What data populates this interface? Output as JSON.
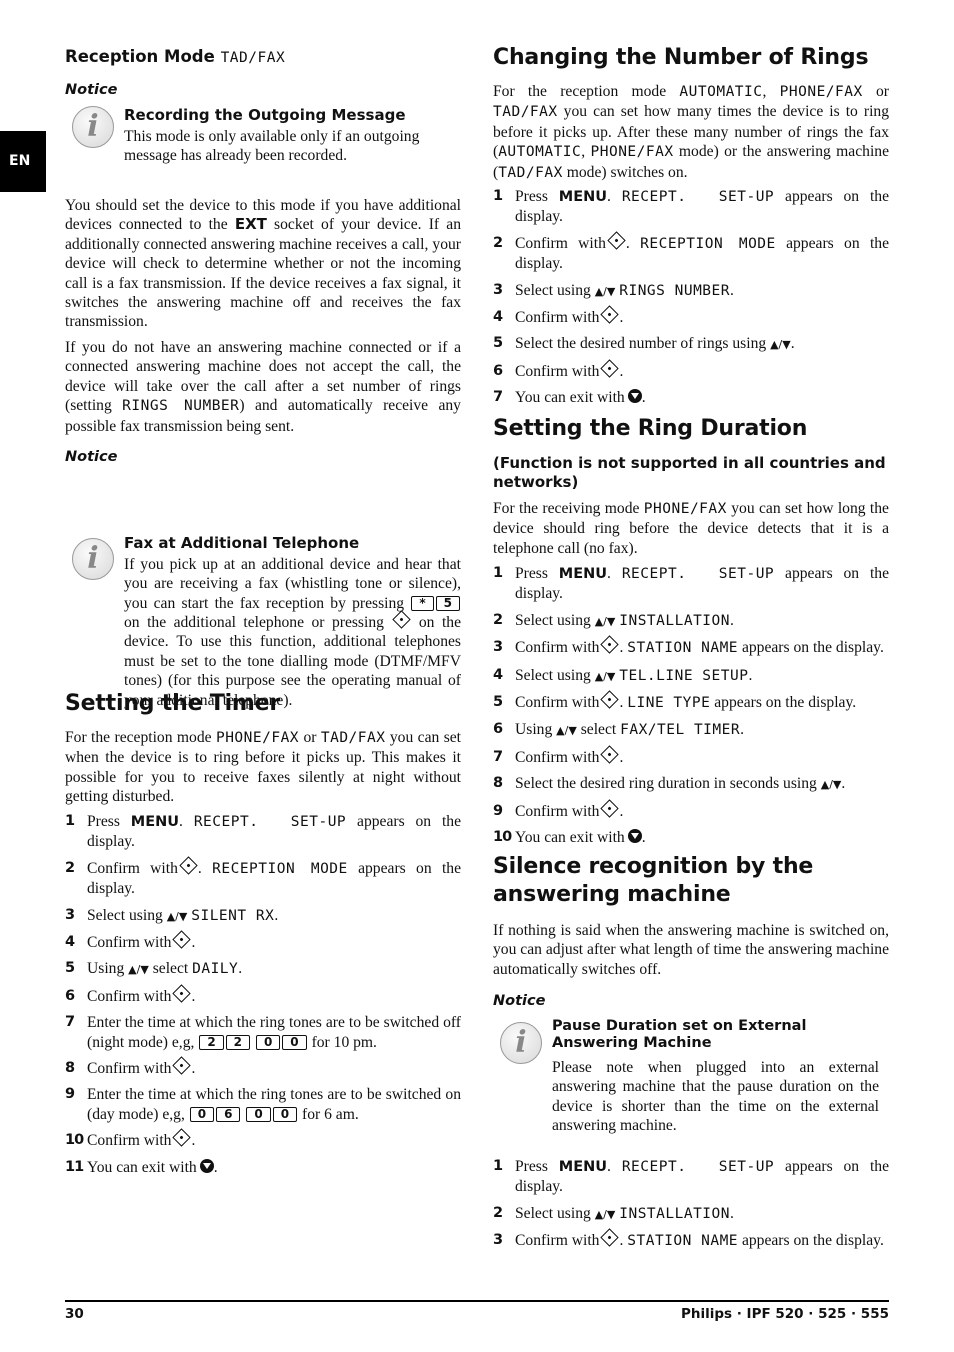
{
  "lang_tab": "EN",
  "left": {
    "reception_heading": "Reception Mode",
    "reception_heading_mode": "TAD/FAX",
    "notice1": {
      "label": "Notice",
      "title": "Recording the Outgoing Message",
      "text": "This mode is only available only if an outgoing message has already been recorded."
    },
    "para1_a": "You should set the device to this mode if you have additional devices connected to the",
    "para1_ext": "EXT",
    "para1_b": "socket of your device. If an additionally connected answering machine receives a call, your device will check to determine whether or not the incoming call is a fax transmission. If the device receives a fax signal, it switches the answering machine off and receives the fax transmission.",
    "para2_a": "If you do not have an answering machine connected or if a connected answering machine does not accept the call, the device will take over the call after a set number of rings (setting",
    "para2_lcd": "RINGS NUMBER",
    "para2_b": ") and automatically receive any possible fax transmission being sent.",
    "notice2": {
      "label": "Notice",
      "title": "Fax at Additional Telephone",
      "text_a": "If you pick up at an additional device and hear that you are receiving a fax (whistling tone or silence), you can start the fax reception by pressing",
      "keys": [
        "*",
        "5"
      ],
      "text_b": "on the additional telephone or pressing",
      "text_c": "on the device. To use this function, additional telephones must be set to the tone dialling mode (DTMF/MFV tones) (for this purpose see the operating manual of your additional telephone)."
    },
    "timer": {
      "heading": "Setting the Timer",
      "intro_a": "For the reception mode",
      "intro_lcd1": "PHONE/FAX",
      "intro_or": "or",
      "intro_lcd2": "TAD/FAX",
      "intro_b": "you can set when the device is to ring before it picks up. This makes it possible for you to receive faxes silently at night without getting disturbed.",
      "steps": [
        {
          "num": "1",
          "a": "Press",
          "bold": "MENU",
          "b": ".",
          "lcd": "RECEPT.  SET-UP",
          "c": "appears on the display."
        },
        {
          "num": "2",
          "a": "Confirm with",
          "b": ".",
          "lcd": "RECEPTION MODE",
          "c": "appears on the display."
        },
        {
          "num": "3",
          "a": "Select using",
          "lcd": "SILENT RX",
          "c": "."
        },
        {
          "num": "4",
          "a": "Confirm with",
          "c": "."
        },
        {
          "num": "5",
          "a": "Using",
          "b": "select",
          "lcd": "DAILY",
          "c": "."
        },
        {
          "num": "6",
          "a": "Confirm with",
          "c": "."
        },
        {
          "num": "7",
          "a": "Enter the time at which the ring tones are to be switched off (night mode) e,g,",
          "keys1": [
            "2",
            "2"
          ],
          "keys2": [
            "0",
            "0"
          ],
          "c": "for 10 pm."
        },
        {
          "num": "8",
          "a": "Confirm with",
          "c": "."
        },
        {
          "num": "9",
          "a": "Enter the time at which the ring tones are to be switched on (day mode) e,g,",
          "keys1": [
            "0",
            "6"
          ],
          "keys2": [
            "0",
            "0"
          ],
          "c": "for 6 am."
        },
        {
          "num": "10",
          "a": "Confirm with",
          "c": "."
        },
        {
          "num": "11",
          "a": "You can exit with",
          "c": "."
        }
      ]
    }
  },
  "right": {
    "rings": {
      "heading": "Changing the Number of Rings",
      "intro_a": "For the reception mode",
      "lcd_auto": "AUTOMATIC",
      "lcd_phonefax": "PHONE/FAX",
      "lcd_tadfax": "TAD/FAX",
      "intro_or": "or",
      "intro_b": "you can set how many times the device is to ring before it picks up. After these many number of rings the fax",
      "intro_c": "mode) or the answering machine (",
      "intro_d": "mode) switches on.",
      "steps": [
        {
          "num": "1",
          "a": "Press",
          "bold": "MENU",
          "b": ".",
          "lcd": "RECEPT.  SET-UP",
          "c": "appears on the display."
        },
        {
          "num": "2",
          "a": "Confirm with",
          "b": ".",
          "lcd": "RECEPTION MODE",
          "c": "appears on the display."
        },
        {
          "num": "3",
          "a": "Select using",
          "lcd": "RINGS NUMBER",
          "c": "."
        },
        {
          "num": "4",
          "a": "Confirm with",
          "c": "."
        },
        {
          "num": "5",
          "a": "Select the desired number of rings using",
          "c": "."
        },
        {
          "num": "6",
          "a": "Confirm with",
          "c": "."
        },
        {
          "num": "7",
          "a": "You can exit with",
          "c": "."
        }
      ]
    },
    "duration": {
      "heading": "Setting the Ring Duration",
      "subheading": "(Function is not supported in all countries and networks)",
      "intro_a": "For the receiving mode",
      "intro_lcd": "PHONE/FAX",
      "intro_b": "you can set how long the device should ring before the device detects that it is a telephone call (no fax).",
      "steps": [
        {
          "num": "1",
          "a": "Press",
          "bold": "MENU",
          "b": ".",
          "lcd": "RECEPT.  SET-UP",
          "c": "appears on the display."
        },
        {
          "num": "2",
          "a": "Select using",
          "lcd": "INSTALLATION",
          "c": "."
        },
        {
          "num": "3",
          "a": "Confirm with",
          "b": ".",
          "lcd": "STATION NAME",
          "c": "appears on the display."
        },
        {
          "num": "4",
          "a": "Select using",
          "lcd": "TEL.LINE SETUP",
          "c": "."
        },
        {
          "num": "5",
          "a": "Confirm with",
          "b": ".",
          "lcd": "LINE TYPE",
          "c": "appears on the display."
        },
        {
          "num": "6",
          "a": "Using",
          "b": "select",
          "lcd": "FAX/TEL TIMER",
          "c": "."
        },
        {
          "num": "7",
          "a": "Confirm with",
          "c": "."
        },
        {
          "num": "8",
          "a": "Select the desired ring duration in seconds using",
          "c": "."
        },
        {
          "num": "9",
          "a": "Confirm with",
          "c": "."
        },
        {
          "num": "10",
          "a": "You can exit with",
          "c": "."
        }
      ]
    },
    "silence": {
      "heading": "Silence recognition by the answering machine",
      "intro": "If nothing is said when the answering machine is switched on, you can adjust after what length of time the answering machine automatically switches off.",
      "notice": {
        "label": "Notice",
        "title": "Pause Duration set on External Answering Machine",
        "text": "Please note when plugged into an external answering machine that the pause duration on the device is shorter than the time on the external answering machine."
      },
      "steps": [
        {
          "num": "1",
          "a": "Press",
          "bold": "MENU",
          "b": ".",
          "lcd": "RECEPT.  SET-UP",
          "c": "appears on the display."
        },
        {
          "num": "2",
          "a": "Select using",
          "lcd": "INSTALLATION",
          "c": "."
        },
        {
          "num": "3",
          "a": "Confirm with",
          "b": ".",
          "lcd": "STATION NAME",
          "c": "appears on the display."
        }
      ]
    }
  },
  "footer": {
    "page_number": "30",
    "brand": "Philips · IPF 520 · 525 · 555"
  },
  "icons": {
    "updown": "▲/▼"
  }
}
